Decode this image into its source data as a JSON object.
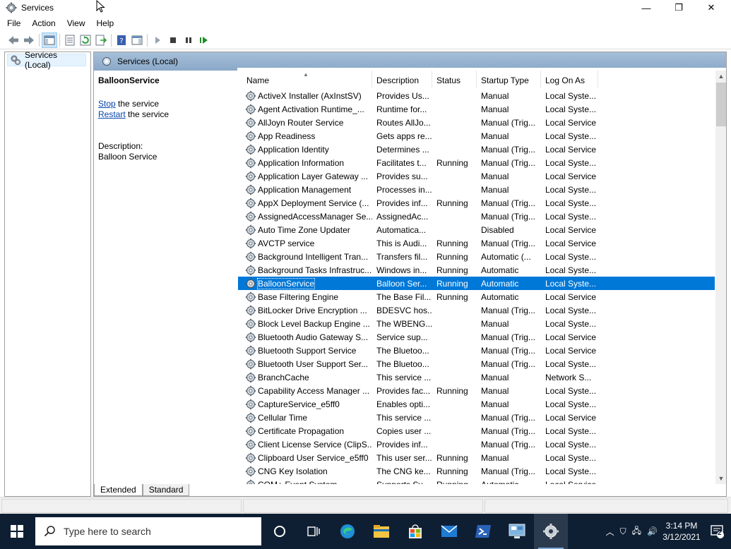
{
  "window": {
    "title": "Services",
    "minimize": "—",
    "maximize": "❐",
    "close": "✕"
  },
  "menu": [
    "File",
    "Action",
    "View",
    "Help"
  ],
  "toolbar": {
    "icons": [
      "back-icon",
      "forward-icon",
      "show-hide-console-tree-icon",
      "properties-icon",
      "refresh-icon",
      "export-list-icon",
      "help-icon",
      "action-pane-icon",
      "start-service-icon",
      "stop-service-icon",
      "pause-service-icon",
      "restart-service-icon"
    ]
  },
  "tree": {
    "root_label": "Services (Local)"
  },
  "pane": {
    "header": "Services (Local)",
    "selected_service": "BalloonService",
    "stop_link": "Stop",
    "stop_rest": " the service",
    "restart_link": "Restart",
    "restart_rest": " the service",
    "description_label": "Description:",
    "description_text": "Balloon Service"
  },
  "columns": [
    "Name",
    "Description",
    "Status",
    "Startup Type",
    "Log On As"
  ],
  "services": [
    [
      "ActiveX Installer (AxInstSV)",
      "Provides Us...",
      "",
      "Manual",
      "Local Syste..."
    ],
    [
      "Agent Activation Runtime_...",
      "Runtime for...",
      "",
      "Manual",
      "Local Syste..."
    ],
    [
      "AllJoyn Router Service",
      "Routes AllJo...",
      "",
      "Manual (Trig...",
      "Local Service"
    ],
    [
      "App Readiness",
      "Gets apps re...",
      "",
      "Manual",
      "Local Syste..."
    ],
    [
      "Application Identity",
      "Determines ...",
      "",
      "Manual (Trig...",
      "Local Service"
    ],
    [
      "Application Information",
      "Facilitates t...",
      "Running",
      "Manual (Trig...",
      "Local Syste..."
    ],
    [
      "Application Layer Gateway ...",
      "Provides su...",
      "",
      "Manual",
      "Local Service"
    ],
    [
      "Application Management",
      "Processes in...",
      "",
      "Manual",
      "Local Syste..."
    ],
    [
      "AppX Deployment Service (...",
      "Provides inf...",
      "Running",
      "Manual (Trig...",
      "Local Syste..."
    ],
    [
      "AssignedAccessManager Se...",
      "AssignedAc...",
      "",
      "Manual (Trig...",
      "Local Syste..."
    ],
    [
      "Auto Time Zone Updater",
      "Automatica...",
      "",
      "Disabled",
      "Local Service"
    ],
    [
      "AVCTP service",
      "This is Audi...",
      "Running",
      "Manual (Trig...",
      "Local Service"
    ],
    [
      "Background Intelligent Tran...",
      "Transfers fil...",
      "Running",
      "Automatic (...",
      "Local Syste..."
    ],
    [
      "Background Tasks Infrastruc...",
      "Windows in...",
      "Running",
      "Automatic",
      "Local Syste..."
    ],
    [
      "BalloonService",
      "Balloon Ser...",
      "Running",
      "Automatic",
      "Local Syste..."
    ],
    [
      "Base Filtering Engine",
      "The Base Fil...",
      "Running",
      "Automatic",
      "Local Service"
    ],
    [
      "BitLocker Drive Encryption ...",
      "BDESVC hos...",
      "",
      "Manual (Trig...",
      "Local Syste..."
    ],
    [
      "Block Level Backup Engine ...",
      "The WBENG...",
      "",
      "Manual",
      "Local Syste..."
    ],
    [
      "Bluetooth Audio Gateway S...",
      "Service sup...",
      "",
      "Manual (Trig...",
      "Local Service"
    ],
    [
      "Bluetooth Support Service",
      "The Bluetoo...",
      "",
      "Manual (Trig...",
      "Local Service"
    ],
    [
      "Bluetooth User Support Ser...",
      "The Bluetoo...",
      "",
      "Manual (Trig...",
      "Local Syste..."
    ],
    [
      "BranchCache",
      "This service ...",
      "",
      "Manual",
      "Network S..."
    ],
    [
      "Capability Access Manager ...",
      "Provides fac...",
      "Running",
      "Manual",
      "Local Syste..."
    ],
    [
      "CaptureService_e5ff0",
      "Enables opti...",
      "",
      "Manual",
      "Local Syste..."
    ],
    [
      "Cellular Time",
      "This service ...",
      "",
      "Manual (Trig...",
      "Local Service"
    ],
    [
      "Certificate Propagation",
      "Copies user ...",
      "",
      "Manual (Trig...",
      "Local Syste..."
    ],
    [
      "Client License Service (ClipS...",
      "Provides inf...",
      "",
      "Manual (Trig...",
      "Local Syste..."
    ],
    [
      "Clipboard User Service_e5ff0",
      "This user ser...",
      "Running",
      "Manual",
      "Local Syste..."
    ],
    [
      "CNG Key Isolation",
      "The CNG ke...",
      "Running",
      "Manual (Trig...",
      "Local Syste..."
    ],
    [
      "COM+ Event System",
      "Supports Sy...",
      "Running",
      "Automatic",
      "Local Service"
    ]
  ],
  "selected_row": 14,
  "tabs": [
    "Extended",
    "Standard"
  ],
  "taskbar": {
    "search_placeholder": "Type here to search",
    "time": "3:14 PM",
    "date": "3/12/2021",
    "notifications_count": "2"
  },
  "colors": {
    "selection": "#0078d7",
    "taskbar": "#0f1f33",
    "header_band": "#98b3d0"
  }
}
